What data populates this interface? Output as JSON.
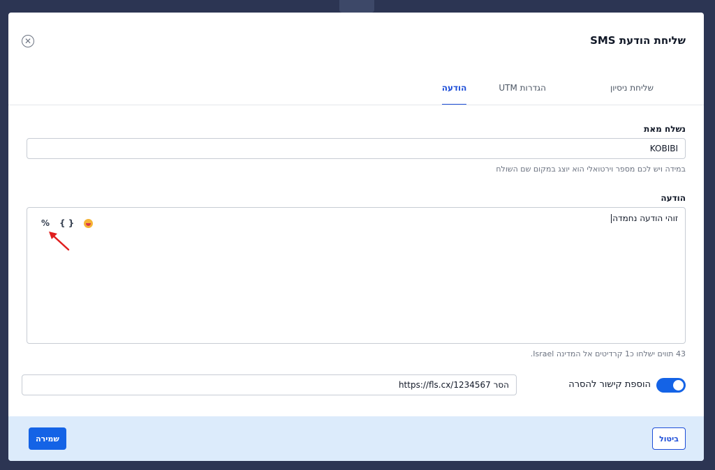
{
  "modal": {
    "title": "שליחת הודעת SMS",
    "tabs": [
      {
        "label": "הודעה",
        "active": true
      },
      {
        "label": "הגדרות UTM",
        "active": false
      },
      {
        "label": "שליחת ניסיון",
        "active": false
      }
    ]
  },
  "sender": {
    "label": "נשלח מאת",
    "value": "KOBIBI",
    "hint": "במידה ויש לכם מספר וירטואלי הוא יוצג במקום שם השולח"
  },
  "message": {
    "label": "הודעה",
    "value": "זוהי הודעה נחמדה",
    "toolbar": {
      "percent": "%",
      "braces": "{ }",
      "emoji_icon": "emoji-icon"
    },
    "credits_info": "43 תווים ישלחו כ1 קרדיטים אל המדינה Israel."
  },
  "unsubscribe": {
    "toggle_label": "הוספת קישור להסרה",
    "enabled": true,
    "value": "הסר https://fls.cx/1234567"
  },
  "footer": {
    "save_label": "שמירה",
    "cancel_label": "ביטול"
  },
  "colors": {
    "accent": "#1463e6",
    "backdrop": "#2c3553",
    "footer_bg": "#dcebfb",
    "annotation_arrow": "#e01e1e"
  }
}
